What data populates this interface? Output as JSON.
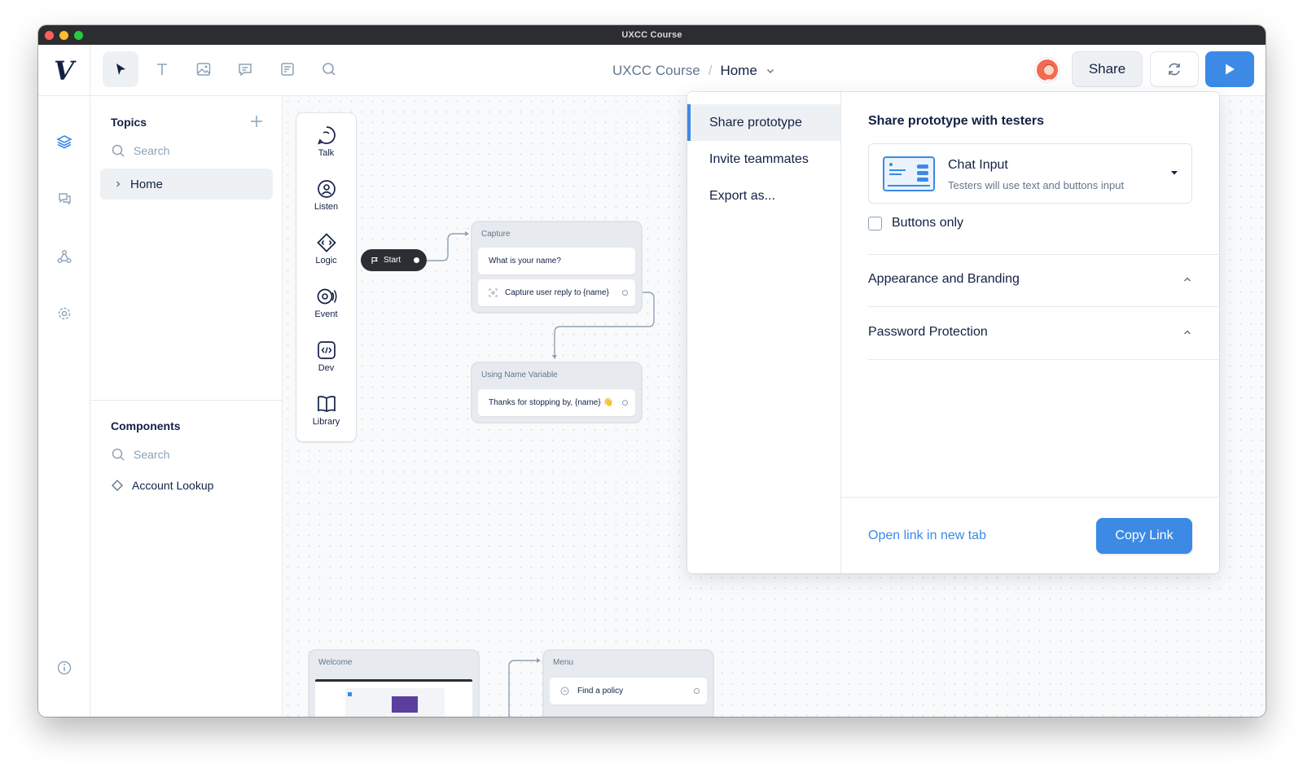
{
  "window": {
    "title": "UXCC Course"
  },
  "topbar": {
    "logo": "V",
    "tools": [
      "pointer-tool",
      "text-tool",
      "image-tool",
      "comment-tool",
      "notes-tool",
      "search-tool"
    ],
    "breadcrumb": {
      "project": "UXCC Course",
      "separator": "/",
      "current": "Home"
    },
    "share_label": "Share"
  },
  "rail": [
    "layers-icon",
    "chat-icon",
    "nodes-icon",
    "settings-icon",
    "info-icon"
  ],
  "sidebar": {
    "topics_title": "Topics",
    "topics_search_placeholder": "Search",
    "topics": [
      {
        "label": "Home"
      }
    ],
    "components_title": "Components",
    "components_search_placeholder": "Search",
    "components": [
      {
        "label": "Account Lookup"
      }
    ]
  },
  "steps": [
    {
      "label": "Talk",
      "icon": "talk-icon"
    },
    {
      "label": "Listen",
      "icon": "listen-icon"
    },
    {
      "label": "Logic",
      "icon": "logic-icon"
    },
    {
      "label": "Event",
      "icon": "event-icon"
    },
    {
      "label": "Dev",
      "icon": "dev-icon"
    },
    {
      "label": "Library",
      "icon": "library-icon"
    }
  ],
  "canvas": {
    "start_label": "Start",
    "capture": {
      "title": "Capture",
      "prompt": "What is your name?",
      "capture": "Capture user reply to {name}"
    },
    "using": {
      "title": "Using Name Variable",
      "message": "Thanks for stopping by, {name} 👋"
    },
    "welcome": {
      "title": "Welcome"
    },
    "menu": {
      "title": "Menu",
      "item": "Find a policy"
    }
  },
  "share_panel": {
    "nav": [
      {
        "label": "Share prototype",
        "active": true
      },
      {
        "label": "Invite teammates",
        "active": false
      },
      {
        "label": "Export as...",
        "active": false
      }
    ],
    "title": "Share prototype with testers",
    "select": {
      "title": "Chat Input",
      "subtitle": "Testers will use text and buttons input"
    },
    "checkbox_label": "Buttons only",
    "checkbox_checked": false,
    "accordions": [
      {
        "label": "Appearance and Branding"
      },
      {
        "label": "Password Protection"
      }
    ],
    "open_link_label": "Open link in new tab",
    "copy_link_label": "Copy Link"
  },
  "colors": {
    "accent": "#3c8ae5",
    "text": "#132144",
    "muted": "#62778c"
  }
}
